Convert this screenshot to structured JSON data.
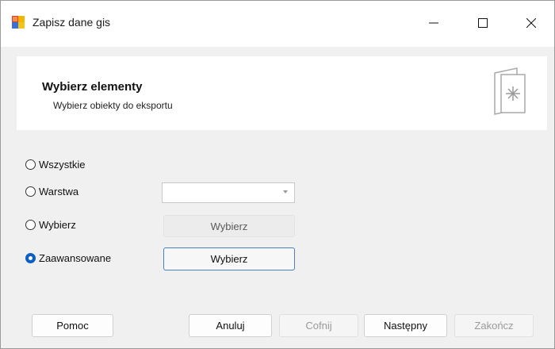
{
  "window": {
    "title": "Zapisz dane gis",
    "controls": {
      "minimize": "—",
      "maximize": "☐",
      "close": "✕"
    }
  },
  "header": {
    "title": "Wybierz elementy",
    "subtitle": "Wybierz obiekty do eksportu"
  },
  "options": [
    {
      "label": "Wszystkie",
      "checked": false
    },
    {
      "label": "Warstwa",
      "checked": false
    },
    {
      "label": "Wybierz",
      "checked": false
    },
    {
      "label": "Zaawansowane",
      "checked": true
    }
  ],
  "layer_combo": {
    "value": ""
  },
  "select_button_label": "Wybierz",
  "advanced_button_label": "Wybierz",
  "footer": {
    "help": "Pomoc",
    "cancel": "Anuluj",
    "back": "Cofnij",
    "next": "Następny",
    "finish": "Zakończ"
  },
  "colors": {
    "accent": "#0b5fc3",
    "panel": "#ffffff",
    "background": "#f0f0f0"
  }
}
